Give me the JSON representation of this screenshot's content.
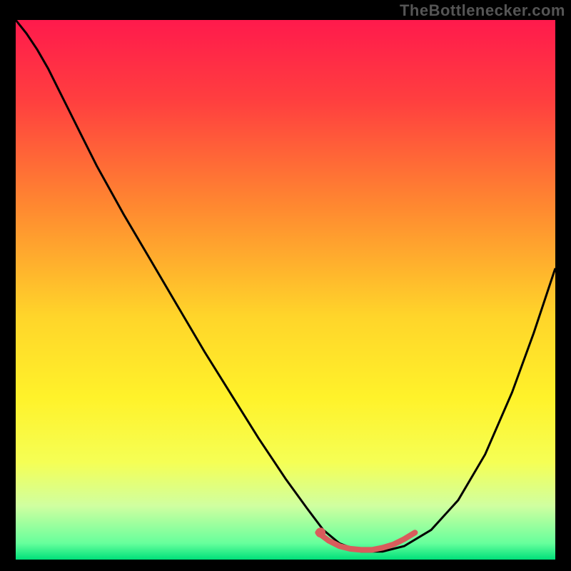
{
  "watermark": "TheBottlenecker.com",
  "chart_data": {
    "type": "line",
    "title": "",
    "xlabel": "",
    "ylabel": "",
    "xlim": [
      0,
      1
    ],
    "ylim": [
      0,
      1
    ],
    "gradient_stops": [
      {
        "offset": 0.0,
        "color": "#ff1a4c"
      },
      {
        "offset": 0.15,
        "color": "#ff3f3f"
      },
      {
        "offset": 0.35,
        "color": "#ff8a30"
      },
      {
        "offset": 0.55,
        "color": "#ffd52a"
      },
      {
        "offset": 0.7,
        "color": "#fff22a"
      },
      {
        "offset": 0.82,
        "color": "#f5ff55"
      },
      {
        "offset": 0.9,
        "color": "#d0ffa0"
      },
      {
        "offset": 0.97,
        "color": "#66ff9c"
      },
      {
        "offset": 1.0,
        "color": "#00e07a"
      }
    ],
    "series": [
      {
        "name": "bottleneck-curve",
        "color": "#000000",
        "x": [
          0.0,
          0.02,
          0.04,
          0.06,
          0.08,
          0.1,
          0.12,
          0.15,
          0.2,
          0.25,
          0.3,
          0.35,
          0.4,
          0.45,
          0.5,
          0.54,
          0.57,
          0.6,
          0.64,
          0.68,
          0.72,
          0.77,
          0.82,
          0.87,
          0.92,
          0.96,
          1.0
        ],
        "y": [
          1.0,
          0.975,
          0.945,
          0.91,
          0.87,
          0.83,
          0.79,
          0.73,
          0.64,
          0.555,
          0.47,
          0.385,
          0.305,
          0.225,
          0.15,
          0.095,
          0.055,
          0.03,
          0.015,
          0.015,
          0.025,
          0.055,
          0.11,
          0.195,
          0.31,
          0.42,
          0.54
        ]
      },
      {
        "name": "optimal-band",
        "color": "#d95c5c",
        "x": [
          0.56,
          0.58,
          0.6,
          0.62,
          0.64,
          0.66,
          0.68,
          0.7,
          0.72,
          0.74
        ],
        "y": [
          0.05,
          0.035,
          0.025,
          0.02,
          0.018,
          0.018,
          0.022,
          0.028,
          0.038,
          0.05
        ]
      }
    ],
    "marker": {
      "x": 0.565,
      "y": 0.05,
      "color": "#d95c5c"
    }
  }
}
